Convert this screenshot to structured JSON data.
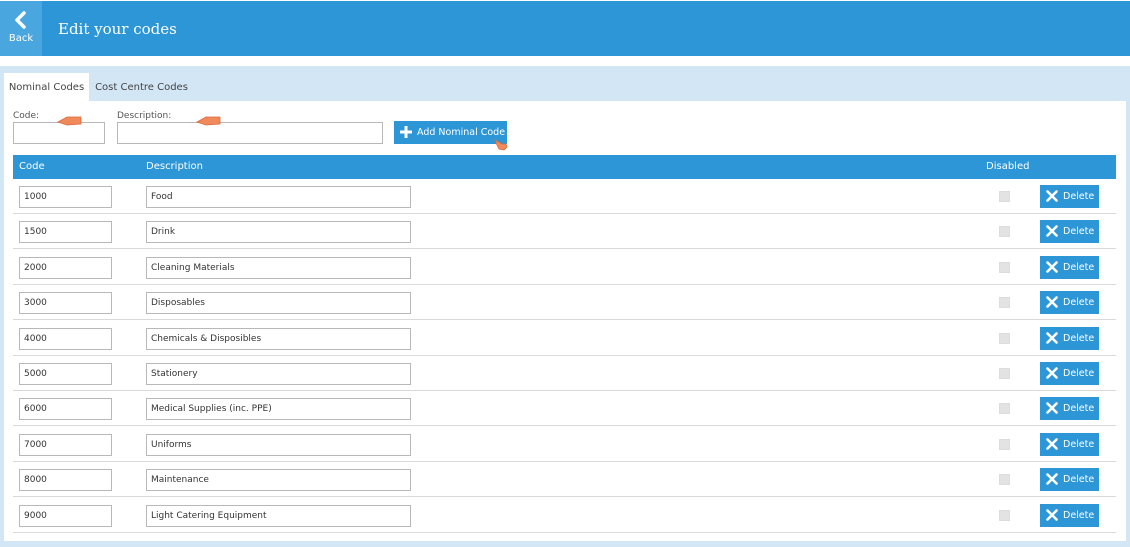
{
  "header": {
    "back_label": "Back",
    "title": "Edit your codes",
    "color": "#2d96d7"
  },
  "tabs": [
    {
      "label": "Nominal Codes",
      "active": true
    },
    {
      "label": "Cost Centre Codes",
      "active": false
    }
  ],
  "form": {
    "code_label": "Code:",
    "code_value": "",
    "description_label": "Description:",
    "description_value": "",
    "add_button_label": "Add Nominal Code"
  },
  "table": {
    "columns": {
      "code": "Code",
      "description": "Description",
      "disabled": "Disabled"
    },
    "delete_label": "Delete",
    "rows": [
      {
        "code": "1000",
        "description": "Food",
        "disabled": false
      },
      {
        "code": "1500",
        "description": "Drink",
        "disabled": false
      },
      {
        "code": "2000",
        "description": "Cleaning Materials",
        "disabled": false
      },
      {
        "code": "3000",
        "description": "Disposables",
        "disabled": false
      },
      {
        "code": "4000",
        "description": "Chemicals & Disposibles",
        "disabled": false
      },
      {
        "code": "5000",
        "description": "Stationery",
        "disabled": false
      },
      {
        "code": "6000",
        "description": "Medical Supplies (inc. PPE)",
        "disabled": false
      },
      {
        "code": "7000",
        "description": "Uniforms",
        "disabled": false
      },
      {
        "code": "8000",
        "description": "Maintenance",
        "disabled": false
      },
      {
        "code": "9000",
        "description": "Light Catering Equipment",
        "disabled": false
      }
    ]
  },
  "icons": {
    "back": "chevron-left-icon",
    "add": "plus-icon",
    "delete": "close-icon",
    "hint": "arrow-hint-icon",
    "cursor": "hand-pointer-icon"
  }
}
